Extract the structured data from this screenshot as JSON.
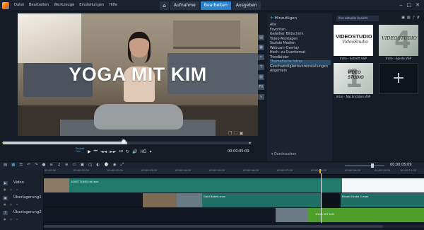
{
  "menu": {
    "items": [
      "Datei",
      "Bearbeiten",
      "Werkzeuge",
      "Einstellungen",
      "Hilfe"
    ]
  },
  "tabs": [
    {
      "label": "⌂",
      "icon": "home-icon"
    },
    {
      "label": "Aufnahme"
    },
    {
      "label": "Bearbeiten",
      "active": true
    },
    {
      "label": "Ausgeben"
    }
  ],
  "window_controls": {
    "minimize": "‒",
    "maximize": "□",
    "close": "✕"
  },
  "preview": {
    "overlay_title": "YOGA MIT KIM",
    "timecode": "00:00:05:09",
    "mode_project": "Projekt",
    "mode_clip": "Clip",
    "playback_position": 0.5
  },
  "transport": {
    "play": "▶",
    "home": "⏮",
    "prev": "◄◄",
    "next": "►►",
    "end": "⏭",
    "repeat": "↻",
    "volume": "🔊",
    "hd": "HD",
    "menu": "▾"
  },
  "library": {
    "add_label": "Hinzufügen",
    "items": [
      "Alle",
      "Favoriten",
      "Geteilter Bildschirm",
      "Video-Montagen",
      "Soziale Medien",
      "Webcam-Overlay",
      "Hoch- zu Querformat",
      "Trendbilder",
      "Thematische Intros",
      "Geschwindigkeitsvoreinstellungen",
      "Allgemein"
    ],
    "active_index": 8,
    "search_label": "Durchsuchen",
    "sort_label": "Ihre aktuelle Ansicht",
    "thumbnails": [
      {
        "caption": "Intro - Schnitt.VSP",
        "title": "VIDEOSTUDIO",
        "sub": "VideoStudio"
      },
      {
        "caption": "Intro - Spiele.VSP",
        "title": "VIDEOSTUDIO",
        "num": "4"
      },
      {
        "caption": "Intro - Nachrichten.VSP",
        "title": "VIDEO STUDIO",
        "num": "1"
      },
      {
        "caption": "",
        "plus": "+"
      }
    ]
  },
  "timeline": {
    "timecode": "00:00:05:09",
    "ruler_ticks": [
      "00:00:00",
      "00:00:01:00",
      "00:00:02:00",
      "00:00:03:00",
      "00:00:04:00",
      "00:00:05:00",
      "00:00:06:00",
      "00:00:07:00",
      "00:00:08:00",
      "00:00:09:00",
      "00:00:10:00",
      "00:00:11:00"
    ],
    "tracks": [
      {
        "label": "Video"
      },
      {
        "label": "Überlagerung1"
      },
      {
        "label": "Überlagerung2"
      }
    ],
    "clips": {
      "video_main": "1008771865.hd.mov",
      "overlay_bokeh": "Gold Bokeh.mov",
      "overlay_brush": "Brush Stroke 2.mov",
      "overlay_title": "YOGA MIT KIM"
    }
  },
  "colors": {
    "accent": "#2d83c9",
    "video_clip": "#1f7a6c",
    "title_clip": "#4e9e2c"
  }
}
